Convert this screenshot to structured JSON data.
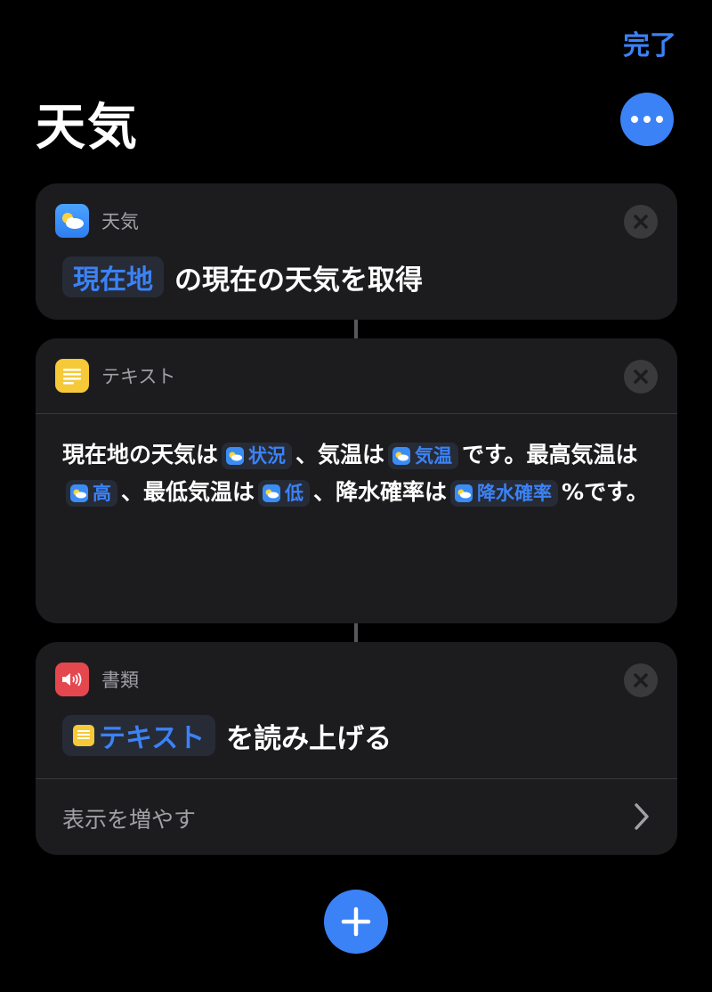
{
  "header": {
    "done_label": "完了",
    "title": "天気"
  },
  "cards": {
    "weather": {
      "app_label": "天気",
      "token": "現在地",
      "action": "の現在の天気を取得"
    },
    "text": {
      "app_label": "テキスト",
      "segments": {
        "s1": "現在地の天気は",
        "t1": "状況",
        "s2": "、気温は",
        "t2": "気温",
        "s3": "です。最高気温は",
        "t3": "高",
        "s4": "、最低気温は",
        "t4": "低",
        "s5": "、降水確率は",
        "t5": "降水確率",
        "s6": "%です。"
      }
    },
    "speak": {
      "app_label": "書類",
      "token": "テキスト",
      "action": "を読み上げる",
      "show_more": "表示を増やす"
    }
  },
  "colors": {
    "accent": "#3b82f6",
    "card": "#1c1c1e",
    "background": "#000000"
  },
  "icons": {
    "more": "ellipsis-icon",
    "close": "close-icon",
    "chevron": "chevron-right-icon",
    "add": "plus-icon"
  }
}
